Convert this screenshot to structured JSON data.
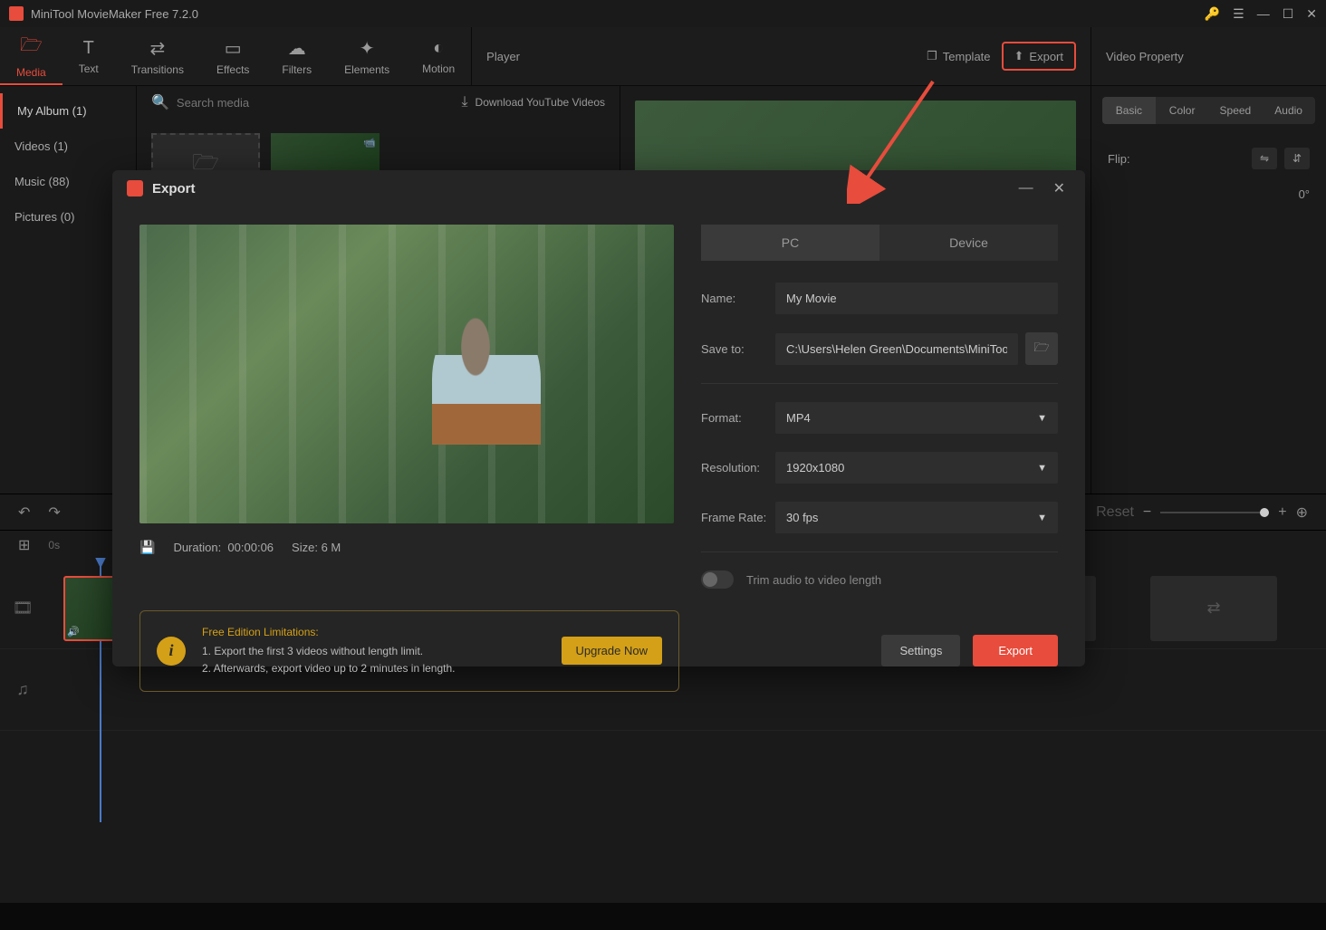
{
  "titlebar": {
    "app_title": "MiniTool MovieMaker Free 7.2.0"
  },
  "toolbar": {
    "items": [
      {
        "label": "Media",
        "icon": "🗁"
      },
      {
        "label": "Text",
        "icon": "T"
      },
      {
        "label": "Transitions",
        "icon": "⇄"
      },
      {
        "label": "Effects",
        "icon": "▭"
      },
      {
        "label": "Filters",
        "icon": "☁"
      },
      {
        "label": "Elements",
        "icon": "✦"
      },
      {
        "label": "Motion",
        "icon": "◐"
      }
    ]
  },
  "player": {
    "label": "Player",
    "template_label": "Template",
    "export_label": "Export"
  },
  "property": {
    "title": "Video Property",
    "tabs": [
      "Basic",
      "Color",
      "Speed",
      "Audio"
    ],
    "flip_label": "Flip:",
    "rotate_value": "0°"
  },
  "sidebar": {
    "items": [
      {
        "label": "My Album (1)"
      },
      {
        "label": "Videos (1)"
      },
      {
        "label": "Music (88)"
      },
      {
        "label": "Pictures (0)"
      }
    ]
  },
  "media": {
    "search_placeholder": "Search media",
    "download_label": "Download YouTube Videos"
  },
  "timeline": {
    "time_label": "0s",
    "reset_label": "Reset"
  },
  "export_dialog": {
    "title": "Export",
    "tabs": {
      "pc": "PC",
      "device": "Device"
    },
    "name_label": "Name:",
    "name_value": "My Movie",
    "saveto_label": "Save to:",
    "saveto_value": "C:\\Users\\Helen Green\\Documents\\MiniTool MovieM",
    "format_label": "Format:",
    "format_value": "MP4",
    "resolution_label": "Resolution:",
    "resolution_value": "1920x1080",
    "framerate_label": "Frame Rate:",
    "framerate_value": "30 fps",
    "trim_label": "Trim audio to video length",
    "duration_label": "Duration:",
    "duration_value": "00:00:06",
    "size_label": "Size:",
    "size_value": "6 M",
    "limitation_title": "Free Edition Limitations:",
    "limitation_line1": "1. Export the first 3 videos without length limit.",
    "limitation_line2": "2. Afterwards, export video up to 2 minutes in length.",
    "upgrade_label": "Upgrade Now",
    "settings_label": "Settings",
    "export_label": "Export"
  }
}
